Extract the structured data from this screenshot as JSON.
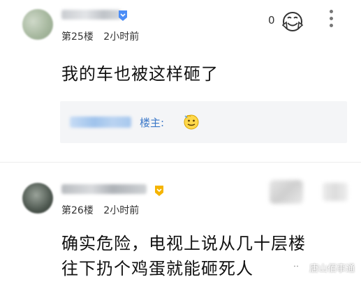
{
  "comments": [
    {
      "floor": "第25楼",
      "time": "2小时前",
      "like_count": "0",
      "content": "我的车也被这样砸了",
      "reply": {
        "label": "楼主:"
      }
    },
    {
      "floor": "第26楼",
      "time": "2小时前",
      "content_line1": "确实危险，电视上说从几十层楼",
      "content_line2": "往下扔个鸡蛋就能砸死人"
    }
  ],
  "watermark": {
    "text": "唐山佰事通"
  },
  "icons": {
    "badge": "vip-badge-icon",
    "like": "like-emoji-icon",
    "more": "more-vertical-icon",
    "reply_emoji": "smile-emoji-icon",
    "watermark": "wechat-icon"
  },
  "colors": {
    "link_blue": "#3b78c8",
    "reply_bg": "#f4f5f7",
    "badge_blue": "#4c8df6",
    "badge_gold": "#f5b400"
  }
}
